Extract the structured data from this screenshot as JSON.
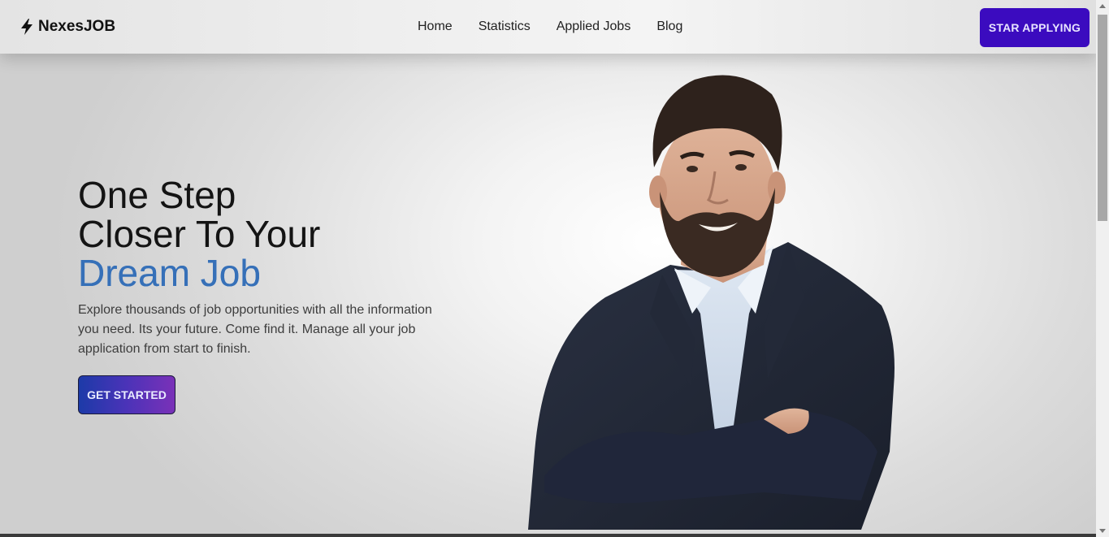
{
  "brand": {
    "name": "NexesJOB",
    "icon": "bolt-icon"
  },
  "nav": {
    "items": [
      {
        "label": "Home"
      },
      {
        "label": "Statistics"
      },
      {
        "label": "Applied Jobs"
      },
      {
        "label": "Blog"
      }
    ],
    "cta_label": "STAR APPLYING"
  },
  "hero": {
    "headline_line1": "One Step",
    "headline_line2": "Closer To Your",
    "headline_accent": "Dream Job",
    "description": "Explore thousands of job opportunities with all the information you need. Its your future. Come find it. Manage all your job application from start to finish.",
    "cta_label": "GET STARTED",
    "image": "smiling-man-in-blazer-portrait"
  },
  "colors": {
    "brand_button": "#3b0bbf",
    "accent_text": "#3670b8",
    "gradient_start": "#1c3aa8",
    "gradient_end": "#7a31b8"
  }
}
